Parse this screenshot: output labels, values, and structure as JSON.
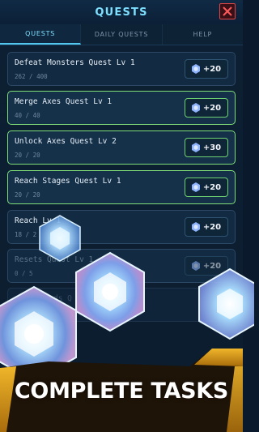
{
  "header": {
    "title": "QUESTS"
  },
  "tabs": [
    {
      "label": "QUESTS",
      "active": true
    },
    {
      "label": "DAILY QUESTS",
      "active": false
    },
    {
      "label": "HELP",
      "active": false
    }
  ],
  "quests": [
    {
      "name": "Defeat Monsters Quest Lv 1",
      "progress": "262 / 400",
      "reward": "+20",
      "completed": false
    },
    {
      "name": "Merge Axes Quest Lv 1",
      "progress": "40 / 40",
      "reward": "+20",
      "completed": true
    },
    {
      "name": "Unlock Axes Quest Lv 2",
      "progress": "20 / 20",
      "reward": "+30",
      "completed": true
    },
    {
      "name": "Reach Stages Quest Lv 1",
      "progress": "20 / 20",
      "reward": "+20",
      "completed": true
    },
    {
      "name": "Reach Lv 1",
      "progress": "18 / 2",
      "reward": "+20",
      "completed": false
    },
    {
      "name": "Resets Quest Lv 1",
      "progress": "0 / 5",
      "reward": "+20",
      "completed": false
    },
    {
      "name": "ds Q",
      "progress": "",
      "reward": "",
      "completed": false
    }
  ],
  "promo": {
    "text": "COMPLETE TASKS"
  },
  "colors": {
    "accent": "#7ee0ff",
    "completed_border": "#7fde78",
    "close": "#e04646",
    "banner": "#c98a14"
  }
}
